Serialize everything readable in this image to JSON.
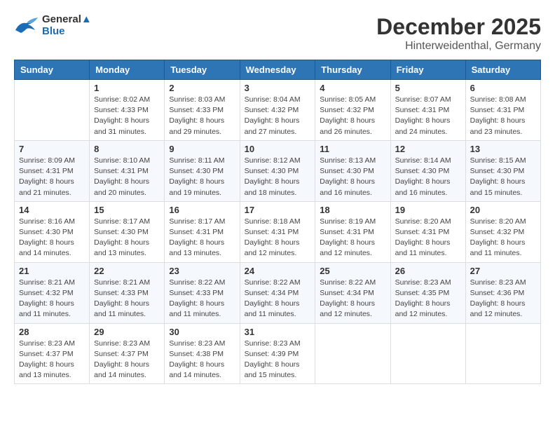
{
  "header": {
    "logo_line1": "General",
    "logo_line2": "Blue",
    "month_year": "December 2025",
    "location": "Hinterweidenthal, Germany"
  },
  "days_of_week": [
    "Sunday",
    "Monday",
    "Tuesday",
    "Wednesday",
    "Thursday",
    "Friday",
    "Saturday"
  ],
  "weeks": [
    [
      {
        "day": "",
        "info": ""
      },
      {
        "day": "1",
        "info": "Sunrise: 8:02 AM\nSunset: 4:33 PM\nDaylight: 8 hours\nand 31 minutes."
      },
      {
        "day": "2",
        "info": "Sunrise: 8:03 AM\nSunset: 4:33 PM\nDaylight: 8 hours\nand 29 minutes."
      },
      {
        "day": "3",
        "info": "Sunrise: 8:04 AM\nSunset: 4:32 PM\nDaylight: 8 hours\nand 27 minutes."
      },
      {
        "day": "4",
        "info": "Sunrise: 8:05 AM\nSunset: 4:32 PM\nDaylight: 8 hours\nand 26 minutes."
      },
      {
        "day": "5",
        "info": "Sunrise: 8:07 AM\nSunset: 4:31 PM\nDaylight: 8 hours\nand 24 minutes."
      },
      {
        "day": "6",
        "info": "Sunrise: 8:08 AM\nSunset: 4:31 PM\nDaylight: 8 hours\nand 23 minutes."
      }
    ],
    [
      {
        "day": "7",
        "info": "Sunrise: 8:09 AM\nSunset: 4:31 PM\nDaylight: 8 hours\nand 21 minutes."
      },
      {
        "day": "8",
        "info": "Sunrise: 8:10 AM\nSunset: 4:31 PM\nDaylight: 8 hours\nand 20 minutes."
      },
      {
        "day": "9",
        "info": "Sunrise: 8:11 AM\nSunset: 4:30 PM\nDaylight: 8 hours\nand 19 minutes."
      },
      {
        "day": "10",
        "info": "Sunrise: 8:12 AM\nSunset: 4:30 PM\nDaylight: 8 hours\nand 18 minutes."
      },
      {
        "day": "11",
        "info": "Sunrise: 8:13 AM\nSunset: 4:30 PM\nDaylight: 8 hours\nand 16 minutes."
      },
      {
        "day": "12",
        "info": "Sunrise: 8:14 AM\nSunset: 4:30 PM\nDaylight: 8 hours\nand 16 minutes."
      },
      {
        "day": "13",
        "info": "Sunrise: 8:15 AM\nSunset: 4:30 PM\nDaylight: 8 hours\nand 15 minutes."
      }
    ],
    [
      {
        "day": "14",
        "info": "Sunrise: 8:16 AM\nSunset: 4:30 PM\nDaylight: 8 hours\nand 14 minutes."
      },
      {
        "day": "15",
        "info": "Sunrise: 8:17 AM\nSunset: 4:30 PM\nDaylight: 8 hours\nand 13 minutes."
      },
      {
        "day": "16",
        "info": "Sunrise: 8:17 AM\nSunset: 4:31 PM\nDaylight: 8 hours\nand 13 minutes."
      },
      {
        "day": "17",
        "info": "Sunrise: 8:18 AM\nSunset: 4:31 PM\nDaylight: 8 hours\nand 12 minutes."
      },
      {
        "day": "18",
        "info": "Sunrise: 8:19 AM\nSunset: 4:31 PM\nDaylight: 8 hours\nand 12 minutes."
      },
      {
        "day": "19",
        "info": "Sunrise: 8:20 AM\nSunset: 4:31 PM\nDaylight: 8 hours\nand 11 minutes."
      },
      {
        "day": "20",
        "info": "Sunrise: 8:20 AM\nSunset: 4:32 PM\nDaylight: 8 hours\nand 11 minutes."
      }
    ],
    [
      {
        "day": "21",
        "info": "Sunrise: 8:21 AM\nSunset: 4:32 PM\nDaylight: 8 hours\nand 11 minutes."
      },
      {
        "day": "22",
        "info": "Sunrise: 8:21 AM\nSunset: 4:33 PM\nDaylight: 8 hours\nand 11 minutes."
      },
      {
        "day": "23",
        "info": "Sunrise: 8:22 AM\nSunset: 4:33 PM\nDaylight: 8 hours\nand 11 minutes."
      },
      {
        "day": "24",
        "info": "Sunrise: 8:22 AM\nSunset: 4:34 PM\nDaylight: 8 hours\nand 11 minutes."
      },
      {
        "day": "25",
        "info": "Sunrise: 8:22 AM\nSunset: 4:34 PM\nDaylight: 8 hours\nand 12 minutes."
      },
      {
        "day": "26",
        "info": "Sunrise: 8:23 AM\nSunset: 4:35 PM\nDaylight: 8 hours\nand 12 minutes."
      },
      {
        "day": "27",
        "info": "Sunrise: 8:23 AM\nSunset: 4:36 PM\nDaylight: 8 hours\nand 12 minutes."
      }
    ],
    [
      {
        "day": "28",
        "info": "Sunrise: 8:23 AM\nSunset: 4:37 PM\nDaylight: 8 hours\nand 13 minutes."
      },
      {
        "day": "29",
        "info": "Sunrise: 8:23 AM\nSunset: 4:37 PM\nDaylight: 8 hours\nand 14 minutes."
      },
      {
        "day": "30",
        "info": "Sunrise: 8:23 AM\nSunset: 4:38 PM\nDaylight: 8 hours\nand 14 minutes."
      },
      {
        "day": "31",
        "info": "Sunrise: 8:23 AM\nSunset: 4:39 PM\nDaylight: 8 hours\nand 15 minutes."
      },
      {
        "day": "",
        "info": ""
      },
      {
        "day": "",
        "info": ""
      },
      {
        "day": "",
        "info": ""
      }
    ]
  ]
}
